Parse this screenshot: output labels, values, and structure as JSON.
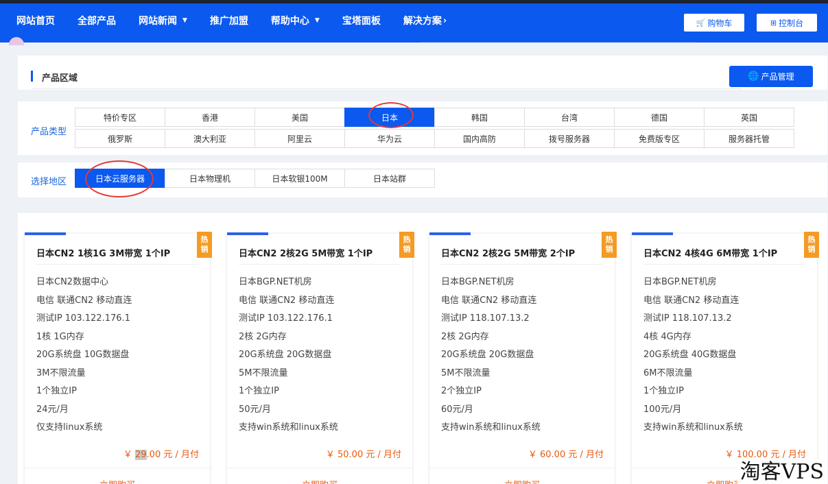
{
  "nav": {
    "items": [
      {
        "label": "网站首页",
        "dropdown": false
      },
      {
        "label": "全部产品",
        "dropdown": false
      },
      {
        "label": "网站新闻",
        "dropdown": true
      },
      {
        "label": "推广加盟",
        "dropdown": false
      },
      {
        "label": "帮助中心",
        "dropdown": true
      },
      {
        "label": "宝塔面板",
        "dropdown": false
      },
      {
        "label": "解决方案",
        "arrow": true
      }
    ],
    "cart_label": "购物车",
    "console_label": "控制台"
  },
  "section": {
    "title": "产品区域",
    "manage_label": "产品管理"
  },
  "product_type": {
    "label": "产品类型",
    "options": [
      "特价专区",
      "香港",
      "美国",
      "日本",
      "韩国",
      "台湾",
      "德国",
      "英国",
      "俄罗斯",
      "澳大利亚",
      "阿里云",
      "华为云",
      "国内高防",
      "拨号服务器",
      "免费版专区",
      "服务器托管"
    ],
    "selected": "日本"
  },
  "region": {
    "label": "选择地区",
    "options": [
      "日本云服务器",
      "日本物理机",
      "日本软银100M",
      "日本站群"
    ],
    "selected": "日本云服务器"
  },
  "products": [
    {
      "name": "日本CN2 1核1G 3M带宽 1个IP",
      "badge": "热销",
      "features": [
        "日本CN2数据中心",
        "电信 联通CN2 移动直连",
        "测试IP 103.122.176.1",
        "1核 1G内存",
        "20G系统盘 10G数据盘",
        "3M不限流量",
        "1个独立IP",
        "24元/月",
        "仅支持linux系统"
      ],
      "price_prefix": "￥",
      "price_a": "",
      "price_b": "29",
      "price_c": ".00 元 / 月付",
      "buy_label": "立即购买"
    },
    {
      "name": "日本CN2 2核2G 5M带宽 1个IP",
      "badge": "热销",
      "features": [
        "日本BGP.NET机房",
        "电信 联通CN2 移动直连",
        "测试IP 103.122.176.1",
        "2核 2G内存",
        "20G系统盘 20G数据盘",
        "5M不限流量",
        "1个独立IP",
        "50元/月",
        "支持win系统和linux系统"
      ],
      "price_prefix": "￥",
      "price_a": "50.00 元 / 月付",
      "price_b": "",
      "price_c": "",
      "buy_label": "立即购买"
    },
    {
      "name": "日本CN2 2核2G 5M带宽 2个IP",
      "badge": "热销",
      "features": [
        "日本BGP.NET机房",
        "电信 联通CN2 移动直连",
        "测试IP 118.107.13.2",
        "2核 2G内存",
        "20G系统盘 20G数据盘",
        "5M不限流量",
        "2个独立IP",
        "60元/月",
        "支持win系统和linux系统"
      ],
      "price_prefix": "￥",
      "price_a": "60.00 元 / 月付",
      "price_b": "",
      "price_c": "",
      "buy_label": "立即购买"
    },
    {
      "name": "日本CN2 4核4G 6M带宽 1个IP",
      "badge": "热销",
      "features": [
        "日本BGP.NET机房",
        "电信 联通CN2 移动直连",
        "测试IP 118.107.13.2",
        "4核 4G内存",
        "20G系统盘 40G数据盘",
        "6M不限流量",
        "1个独立IP",
        "100元/月",
        "支持win系统和linux系统"
      ],
      "price_prefix": "￥",
      "price_a": "100.00 元 / 月付",
      "price_b": "",
      "price_c": "",
      "buy_label": "立即购买"
    }
  ],
  "watermark": "淘客VPS",
  "colors": {
    "brand": "#0b59ef",
    "price": "#e8590c",
    "hot_badge": "#f59a23",
    "highlight_ring": "#e53935"
  }
}
